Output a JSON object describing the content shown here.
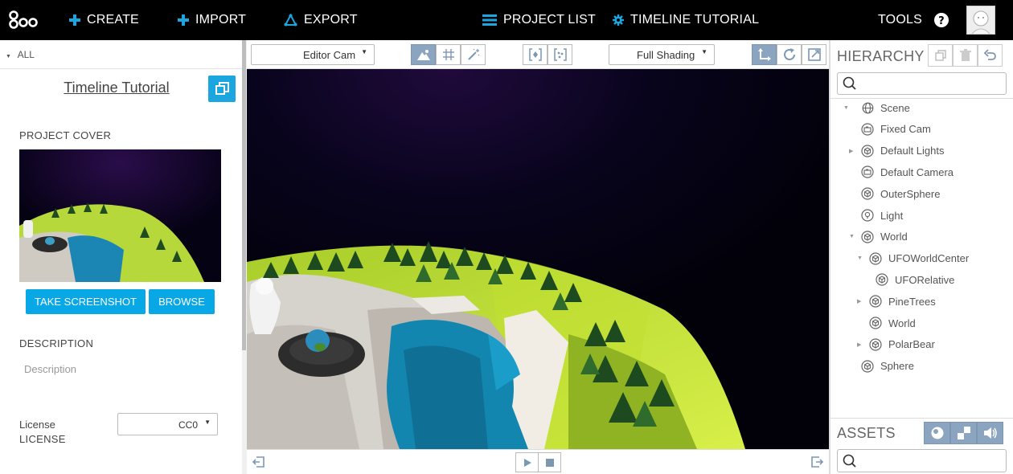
{
  "topbar": {
    "create_label": "CREATE",
    "import_label": "IMPORT",
    "export_label": "EXPORT",
    "project_list_label": "PROJECT LIST",
    "timeline_tutorial_label": "TIMELINE TUTORIAL",
    "tools_label": "TOOLS"
  },
  "left_panel": {
    "filter_label": "ALL",
    "project_title": "Timeline Tutorial",
    "project_cover_heading": "PROJECT COVER",
    "take_screenshot_label": "TAKE SCREENSHOT",
    "browse_label": "BROWSE",
    "description_heading": "DESCRIPTION",
    "description_placeholder": "Description",
    "license_heading": "LICENSE",
    "license_label": "License",
    "license_value": "CC0"
  },
  "viewport_toolbar": {
    "camera_select": "Editor Cam",
    "shading_select": "Full Shading"
  },
  "hierarchy": {
    "title": "HIERARCHY",
    "search_placeholder": "",
    "nodes": [
      {
        "label": "Scene",
        "icon": "globe-icon",
        "depth": 0,
        "arrow": "down"
      },
      {
        "label": "Fixed Cam",
        "icon": "camera-entity-icon",
        "depth": 1,
        "arrow": ""
      },
      {
        "label": "Default Lights",
        "icon": "entity-cube-icon",
        "depth": 1,
        "arrow": "right"
      },
      {
        "label": "Default Camera",
        "icon": "camera-entity-icon",
        "depth": 1,
        "arrow": ""
      },
      {
        "label": "OuterSphere",
        "icon": "entity-cube-icon",
        "depth": 1,
        "arrow": ""
      },
      {
        "label": "Light",
        "icon": "light-entity-icon",
        "depth": 1,
        "arrow": ""
      },
      {
        "label": "World",
        "icon": "entity-cube-icon",
        "depth": 1,
        "arrow": "down"
      },
      {
        "label": "UFOWorldCenter",
        "icon": "entity-cube-icon",
        "depth": 2,
        "arrow": "down"
      },
      {
        "label": "UFORelative",
        "icon": "entity-cube-icon",
        "depth": 3,
        "arrow": ""
      },
      {
        "label": "PineTrees",
        "icon": "entity-cube-icon",
        "depth": 2,
        "arrow": "right"
      },
      {
        "label": "World",
        "icon": "entity-cube-icon",
        "depth": 2,
        "arrow": ""
      },
      {
        "label": "PolarBear",
        "icon": "entity-cube-icon",
        "depth": 2,
        "arrow": "right"
      },
      {
        "label": "Sphere",
        "icon": "entity-cube-icon",
        "depth": 1,
        "arrow": ""
      }
    ]
  },
  "assets": {
    "title": "ASSETS",
    "search_placeholder": ""
  },
  "colors": {
    "topbar_bg": "#000000",
    "accent_blue": "#08a7e6",
    "active_toggle": "#8ba4bf"
  }
}
